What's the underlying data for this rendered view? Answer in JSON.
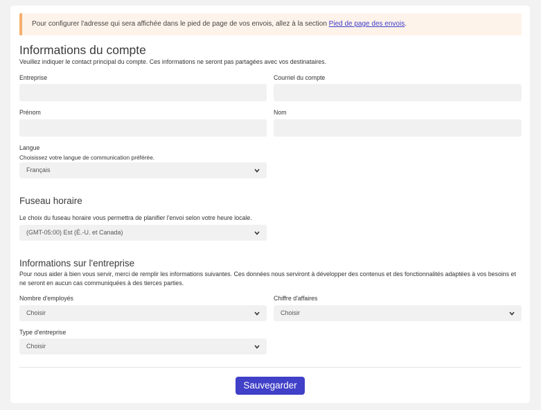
{
  "notice": {
    "text": "Pour configurer l'adresse qui sera affichée dans le pied de page de vos envois, allez à la section ",
    "link": "Pied de page des envois",
    "suffix": "."
  },
  "account": {
    "title": "Informations du compte",
    "description": "Veuillez indiquer le contact principal du compte. Ces informations ne seront pas partagées avec vos destinataires.",
    "company_label": "Entreprise",
    "company_value": "",
    "email_label": "Courriel du compte",
    "email_value": "",
    "firstname_label": "Prénom",
    "firstname_value": "",
    "lastname_label": "Nom",
    "lastname_value": "",
    "language_label": "Langue",
    "language_help": "Choisissez votre langue de communication préférée.",
    "language_value": "Français"
  },
  "timezone": {
    "title": "Fuseau horaire",
    "description": "Le choix du fuseau horaire vous permettra de planifier l'envoi selon votre heure locale.",
    "value": "(GMT-05:00) Est (É.-U. et Canada)"
  },
  "business": {
    "title": "Informations sur l'entreprise",
    "description": "Pour nous aider à bien vous servir, merci de remplir les informations suivantes. Ces données nous serviront à développer des contenus et des fonctionnalités adaptées à vos besoins et ne seront en aucun cas communiquées à des tierces parties.",
    "employees_label": "Nombre d'employés",
    "employees_value": "Choisir",
    "revenue_label": "Chiffre d'affaires",
    "revenue_value": "Choisir",
    "type_label": "Type d'entreprise",
    "type_value": "Choisir"
  },
  "actions": {
    "save_label": "Sauvegarder"
  },
  "icons": {
    "select_chevron": "chevron-down-icon"
  },
  "colors": {
    "primary_button": "#4040c8",
    "notice_bg": "#fef3ea",
    "notice_border": "#f6ae6e",
    "link": "#3b3ccc",
    "field_bg": "#f1f1f1"
  }
}
